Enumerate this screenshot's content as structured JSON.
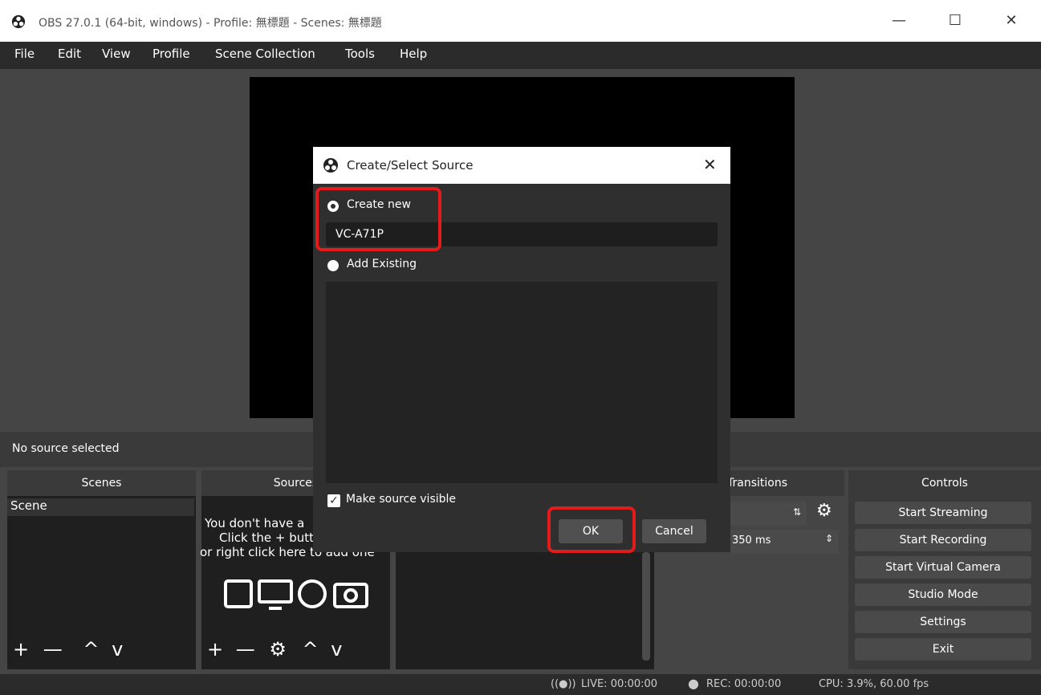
{
  "window": {
    "title": "OBS 27.0.1 (64-bit, windows) - Profile: 無標題 - Scenes: 無標題",
    "minimize": "—",
    "maximize": "☐",
    "close": "✕"
  },
  "menu": [
    "File",
    "Edit",
    "View",
    "Profile",
    "Scene Collection",
    "Tools",
    "Help"
  ],
  "status_line": "No source selected",
  "scenes": {
    "header": "Scenes",
    "items": [
      "Scene"
    ]
  },
  "sources": {
    "header": "Sources",
    "empty_text": [
      "You don't have a",
      "Click the + butt",
      "or right click here to add one"
    ]
  },
  "transitions": {
    "header": "e Transitions",
    "duration": "350 ms"
  },
  "controls": {
    "header": "Controls",
    "buttons": [
      "Start Streaming",
      "Start Recording",
      "Start Virtual Camera",
      "Studio Mode",
      "Settings",
      "Exit"
    ]
  },
  "status": {
    "live": "LIVE: 00:00:00",
    "rec": "REC: 00:00:00",
    "cpu": "CPU: 3.9%, 60.00 fps"
  },
  "dialog": {
    "title": "Create/Select Source",
    "create_new_label": "Create new",
    "name_value": "VC-A71P",
    "add_existing_label": "Add Existing",
    "make_visible_label": "Make source visible",
    "ok": "OK",
    "cancel": "Cancel"
  },
  "colors": {
    "highlight": "#e21b1b",
    "panel": "#2b2b2b",
    "background": "#454545"
  }
}
